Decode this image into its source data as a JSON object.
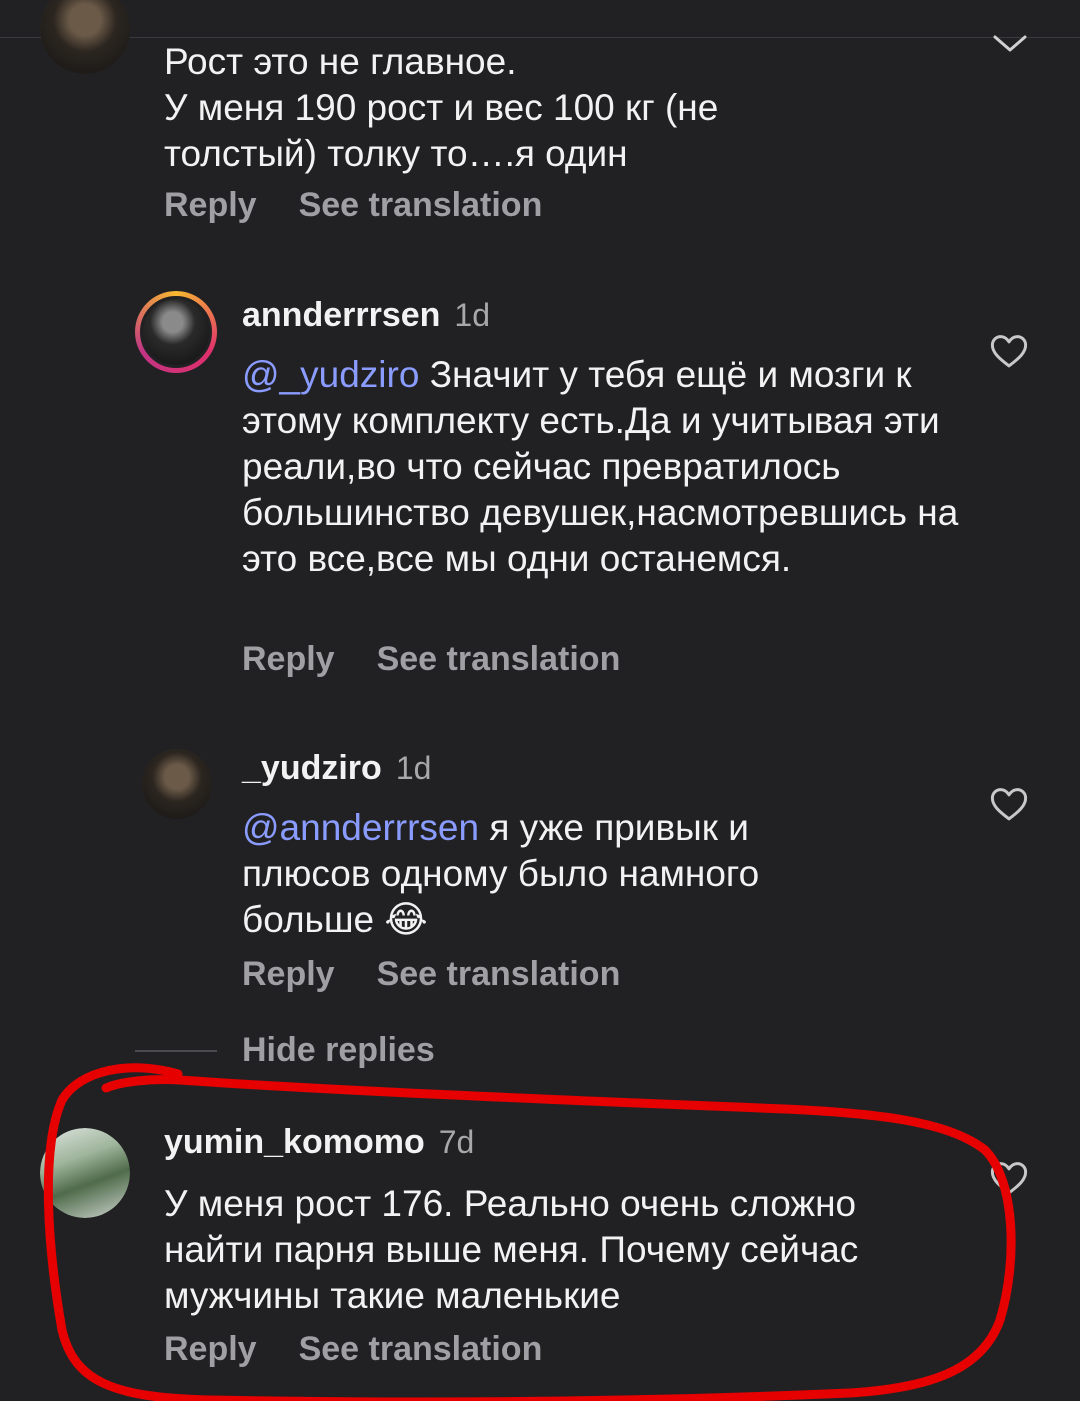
{
  "comments": [
    {
      "text": "Рост это не главное.\nУ меня 190 рост и вес 100 кг (не толстый) толку то….я один",
      "reply": "Reply",
      "translate": "See translation"
    },
    {
      "username": "annderrrsen",
      "time": "1d",
      "mention": "@_yudziro",
      "text": " Значит у тебя ещё и мозги к этому комплекту есть.Да и учитывая эти реали,во что сейчас превратилось большинство девушек,насмотревшись на это все,все мы одни останемся.",
      "reply": "Reply",
      "translate": "See translation"
    },
    {
      "username": "_yudziro",
      "time": "1d",
      "mention": "@annderrrsen",
      "text": " я уже привык и плюсов одному было намного больше 😂",
      "reply": "Reply",
      "translate": "See translation"
    },
    {
      "username": "yumin_komomo",
      "time": "7d",
      "text": "У меня рост 176. Реально очень сложно найти парня выше меня. Почему сейчас мужчины такие маленькие",
      "reply": "Reply",
      "translate": "See translation"
    }
  ],
  "hide_replies": "Hide replies",
  "highlight_color": "#e60000"
}
